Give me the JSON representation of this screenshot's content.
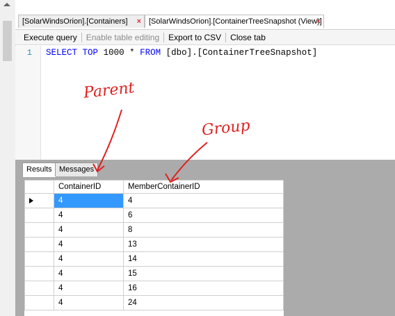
{
  "tabs": [
    {
      "label": "[SolarWindsOrion].[Containers]",
      "active": false
    },
    {
      "label": "[SolarWindsOrion].[ContainerTreeSnapshot (View)]",
      "active": true
    }
  ],
  "toolbar": {
    "execute_label": "Execute query",
    "enable_editing_label": "Enable table editing",
    "export_label": "Export to CSV",
    "close_label": "Close tab"
  },
  "editor": {
    "line_number": "1",
    "sql": {
      "select": "SELECT",
      "top": "TOP",
      "limit": "1000",
      "star": "*",
      "from": "FROM",
      "table": "[dbo].[ContainerTreeSnapshot]"
    }
  },
  "results": {
    "tabs": [
      "Results",
      "Messages"
    ],
    "columns": [
      "ContainerID",
      "MemberContainerID"
    ],
    "rows": [
      [
        "4",
        "4"
      ],
      [
        "4",
        "6"
      ],
      [
        "4",
        "8"
      ],
      [
        "4",
        "13"
      ],
      [
        "4",
        "14"
      ],
      [
        "4",
        "15"
      ],
      [
        "4",
        "16"
      ],
      [
        "4",
        "24"
      ]
    ]
  },
  "annotations": {
    "parent": "Parent",
    "group": "Group",
    "color": "#e02020"
  },
  "icons": {
    "tab_close": "close-icon",
    "row_pointer": "row-pointer-icon"
  }
}
